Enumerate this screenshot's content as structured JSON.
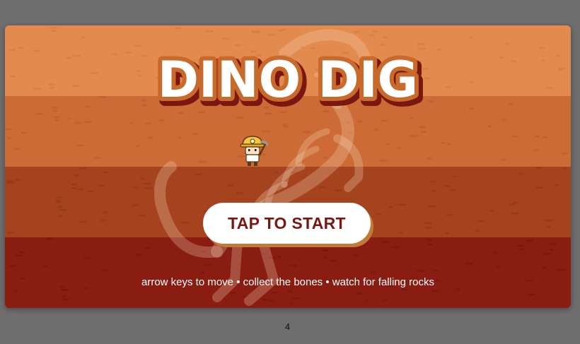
{
  "game": {
    "title": "Dino Dig",
    "title_display": "DINO DIG",
    "start_label": "TAP TO START",
    "hint": "arrow keys to move • collect the bones • watch for falling rocks",
    "icons": [
      "miner-icon",
      "dinosaur-skeleton-icon"
    ]
  },
  "page": {
    "number": "4"
  },
  "colors": {
    "band1": "#e38a4e",
    "band2": "#cd6b36",
    "band3": "#a5431f",
    "band4": "#8a1d12",
    "title_outline": "#b8561f",
    "title_shadow": "#7a1710",
    "button_text": "#7a1710",
    "backdrop": "#6e6e6e"
  }
}
